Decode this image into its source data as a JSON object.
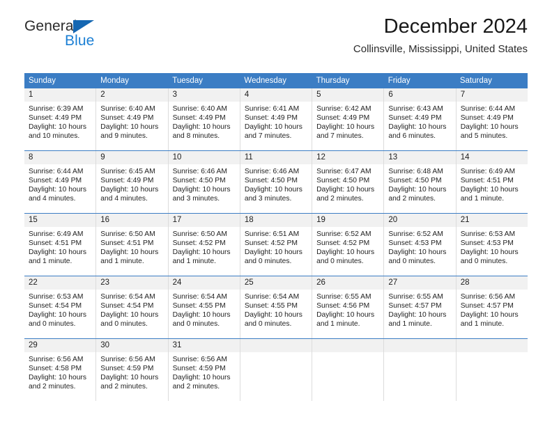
{
  "brand": {
    "name_part1": "General",
    "name_part2": "Blue",
    "accent_color": "#1567b2",
    "blue_text_color": "#1b7fd4"
  },
  "header": {
    "title": "December 2024",
    "subtitle": "Collinsville, Mississippi, United States"
  },
  "calendar": {
    "header_bg": "#3b7dc4",
    "daynum_bg": "#f1f1f1",
    "weekday_headers": [
      "Sunday",
      "Monday",
      "Tuesday",
      "Wednesday",
      "Thursday",
      "Friday",
      "Saturday"
    ],
    "labels": {
      "sunrise": "Sunrise:",
      "sunset": "Sunset:",
      "daylight": "Daylight:"
    },
    "weeks": [
      [
        {
          "day": "1",
          "sunrise": "Sunrise: 6:39 AM",
          "sunset": "Sunset: 4:49 PM",
          "daylight_line1": "Daylight: 10 hours",
          "daylight_line2": "and 10 minutes."
        },
        {
          "day": "2",
          "sunrise": "Sunrise: 6:40 AM",
          "sunset": "Sunset: 4:49 PM",
          "daylight_line1": "Daylight: 10 hours",
          "daylight_line2": "and 9 minutes."
        },
        {
          "day": "3",
          "sunrise": "Sunrise: 6:40 AM",
          "sunset": "Sunset: 4:49 PM",
          "daylight_line1": "Daylight: 10 hours",
          "daylight_line2": "and 8 minutes."
        },
        {
          "day": "4",
          "sunrise": "Sunrise: 6:41 AM",
          "sunset": "Sunset: 4:49 PM",
          "daylight_line1": "Daylight: 10 hours",
          "daylight_line2": "and 7 minutes."
        },
        {
          "day": "5",
          "sunrise": "Sunrise: 6:42 AM",
          "sunset": "Sunset: 4:49 PM",
          "daylight_line1": "Daylight: 10 hours",
          "daylight_line2": "and 7 minutes."
        },
        {
          "day": "6",
          "sunrise": "Sunrise: 6:43 AM",
          "sunset": "Sunset: 4:49 PM",
          "daylight_line1": "Daylight: 10 hours",
          "daylight_line2": "and 6 minutes."
        },
        {
          "day": "7",
          "sunrise": "Sunrise: 6:44 AM",
          "sunset": "Sunset: 4:49 PM",
          "daylight_line1": "Daylight: 10 hours",
          "daylight_line2": "and 5 minutes."
        }
      ],
      [
        {
          "day": "8",
          "sunrise": "Sunrise: 6:44 AM",
          "sunset": "Sunset: 4:49 PM",
          "daylight_line1": "Daylight: 10 hours",
          "daylight_line2": "and 4 minutes."
        },
        {
          "day": "9",
          "sunrise": "Sunrise: 6:45 AM",
          "sunset": "Sunset: 4:49 PM",
          "daylight_line1": "Daylight: 10 hours",
          "daylight_line2": "and 4 minutes."
        },
        {
          "day": "10",
          "sunrise": "Sunrise: 6:46 AM",
          "sunset": "Sunset: 4:50 PM",
          "daylight_line1": "Daylight: 10 hours",
          "daylight_line2": "and 3 minutes."
        },
        {
          "day": "11",
          "sunrise": "Sunrise: 6:46 AM",
          "sunset": "Sunset: 4:50 PM",
          "daylight_line1": "Daylight: 10 hours",
          "daylight_line2": "and 3 minutes."
        },
        {
          "day": "12",
          "sunrise": "Sunrise: 6:47 AM",
          "sunset": "Sunset: 4:50 PM",
          "daylight_line1": "Daylight: 10 hours",
          "daylight_line2": "and 2 minutes."
        },
        {
          "day": "13",
          "sunrise": "Sunrise: 6:48 AM",
          "sunset": "Sunset: 4:50 PM",
          "daylight_line1": "Daylight: 10 hours",
          "daylight_line2": "and 2 minutes."
        },
        {
          "day": "14",
          "sunrise": "Sunrise: 6:49 AM",
          "sunset": "Sunset: 4:51 PM",
          "daylight_line1": "Daylight: 10 hours",
          "daylight_line2": "and 1 minute."
        }
      ],
      [
        {
          "day": "15",
          "sunrise": "Sunrise: 6:49 AM",
          "sunset": "Sunset: 4:51 PM",
          "daylight_line1": "Daylight: 10 hours",
          "daylight_line2": "and 1 minute."
        },
        {
          "day": "16",
          "sunrise": "Sunrise: 6:50 AM",
          "sunset": "Sunset: 4:51 PM",
          "daylight_line1": "Daylight: 10 hours",
          "daylight_line2": "and 1 minute."
        },
        {
          "day": "17",
          "sunrise": "Sunrise: 6:50 AM",
          "sunset": "Sunset: 4:52 PM",
          "daylight_line1": "Daylight: 10 hours",
          "daylight_line2": "and 1 minute."
        },
        {
          "day": "18",
          "sunrise": "Sunrise: 6:51 AM",
          "sunset": "Sunset: 4:52 PM",
          "daylight_line1": "Daylight: 10 hours",
          "daylight_line2": "and 0 minutes."
        },
        {
          "day": "19",
          "sunrise": "Sunrise: 6:52 AM",
          "sunset": "Sunset: 4:52 PM",
          "daylight_line1": "Daylight: 10 hours",
          "daylight_line2": "and 0 minutes."
        },
        {
          "day": "20",
          "sunrise": "Sunrise: 6:52 AM",
          "sunset": "Sunset: 4:53 PM",
          "daylight_line1": "Daylight: 10 hours",
          "daylight_line2": "and 0 minutes."
        },
        {
          "day": "21",
          "sunrise": "Sunrise: 6:53 AM",
          "sunset": "Sunset: 4:53 PM",
          "daylight_line1": "Daylight: 10 hours",
          "daylight_line2": "and 0 minutes."
        }
      ],
      [
        {
          "day": "22",
          "sunrise": "Sunrise: 6:53 AM",
          "sunset": "Sunset: 4:54 PM",
          "daylight_line1": "Daylight: 10 hours",
          "daylight_line2": "and 0 minutes."
        },
        {
          "day": "23",
          "sunrise": "Sunrise: 6:54 AM",
          "sunset": "Sunset: 4:54 PM",
          "daylight_line1": "Daylight: 10 hours",
          "daylight_line2": "and 0 minutes."
        },
        {
          "day": "24",
          "sunrise": "Sunrise: 6:54 AM",
          "sunset": "Sunset: 4:55 PM",
          "daylight_line1": "Daylight: 10 hours",
          "daylight_line2": "and 0 minutes."
        },
        {
          "day": "25",
          "sunrise": "Sunrise: 6:54 AM",
          "sunset": "Sunset: 4:55 PM",
          "daylight_line1": "Daylight: 10 hours",
          "daylight_line2": "and 0 minutes."
        },
        {
          "day": "26",
          "sunrise": "Sunrise: 6:55 AM",
          "sunset": "Sunset: 4:56 PM",
          "daylight_line1": "Daylight: 10 hours",
          "daylight_line2": "and 1 minute."
        },
        {
          "day": "27",
          "sunrise": "Sunrise: 6:55 AM",
          "sunset": "Sunset: 4:57 PM",
          "daylight_line1": "Daylight: 10 hours",
          "daylight_line2": "and 1 minute."
        },
        {
          "day": "28",
          "sunrise": "Sunrise: 6:56 AM",
          "sunset": "Sunset: 4:57 PM",
          "daylight_line1": "Daylight: 10 hours",
          "daylight_line2": "and 1 minute."
        }
      ],
      [
        {
          "day": "29",
          "sunrise": "Sunrise: 6:56 AM",
          "sunset": "Sunset: 4:58 PM",
          "daylight_line1": "Daylight: 10 hours",
          "daylight_line2": "and 2 minutes."
        },
        {
          "day": "30",
          "sunrise": "Sunrise: 6:56 AM",
          "sunset": "Sunset: 4:59 PM",
          "daylight_line1": "Daylight: 10 hours",
          "daylight_line2": "and 2 minutes."
        },
        {
          "day": "31",
          "sunrise": "Sunrise: 6:56 AM",
          "sunset": "Sunset: 4:59 PM",
          "daylight_line1": "Daylight: 10 hours",
          "daylight_line2": "and 2 minutes."
        },
        {
          "day": "",
          "sunrise": "",
          "sunset": "",
          "daylight_line1": "",
          "daylight_line2": ""
        },
        {
          "day": "",
          "sunrise": "",
          "sunset": "",
          "daylight_line1": "",
          "daylight_line2": ""
        },
        {
          "day": "",
          "sunrise": "",
          "sunset": "",
          "daylight_line1": "",
          "daylight_line2": ""
        },
        {
          "day": "",
          "sunrise": "",
          "sunset": "",
          "daylight_line1": "",
          "daylight_line2": ""
        }
      ]
    ]
  }
}
